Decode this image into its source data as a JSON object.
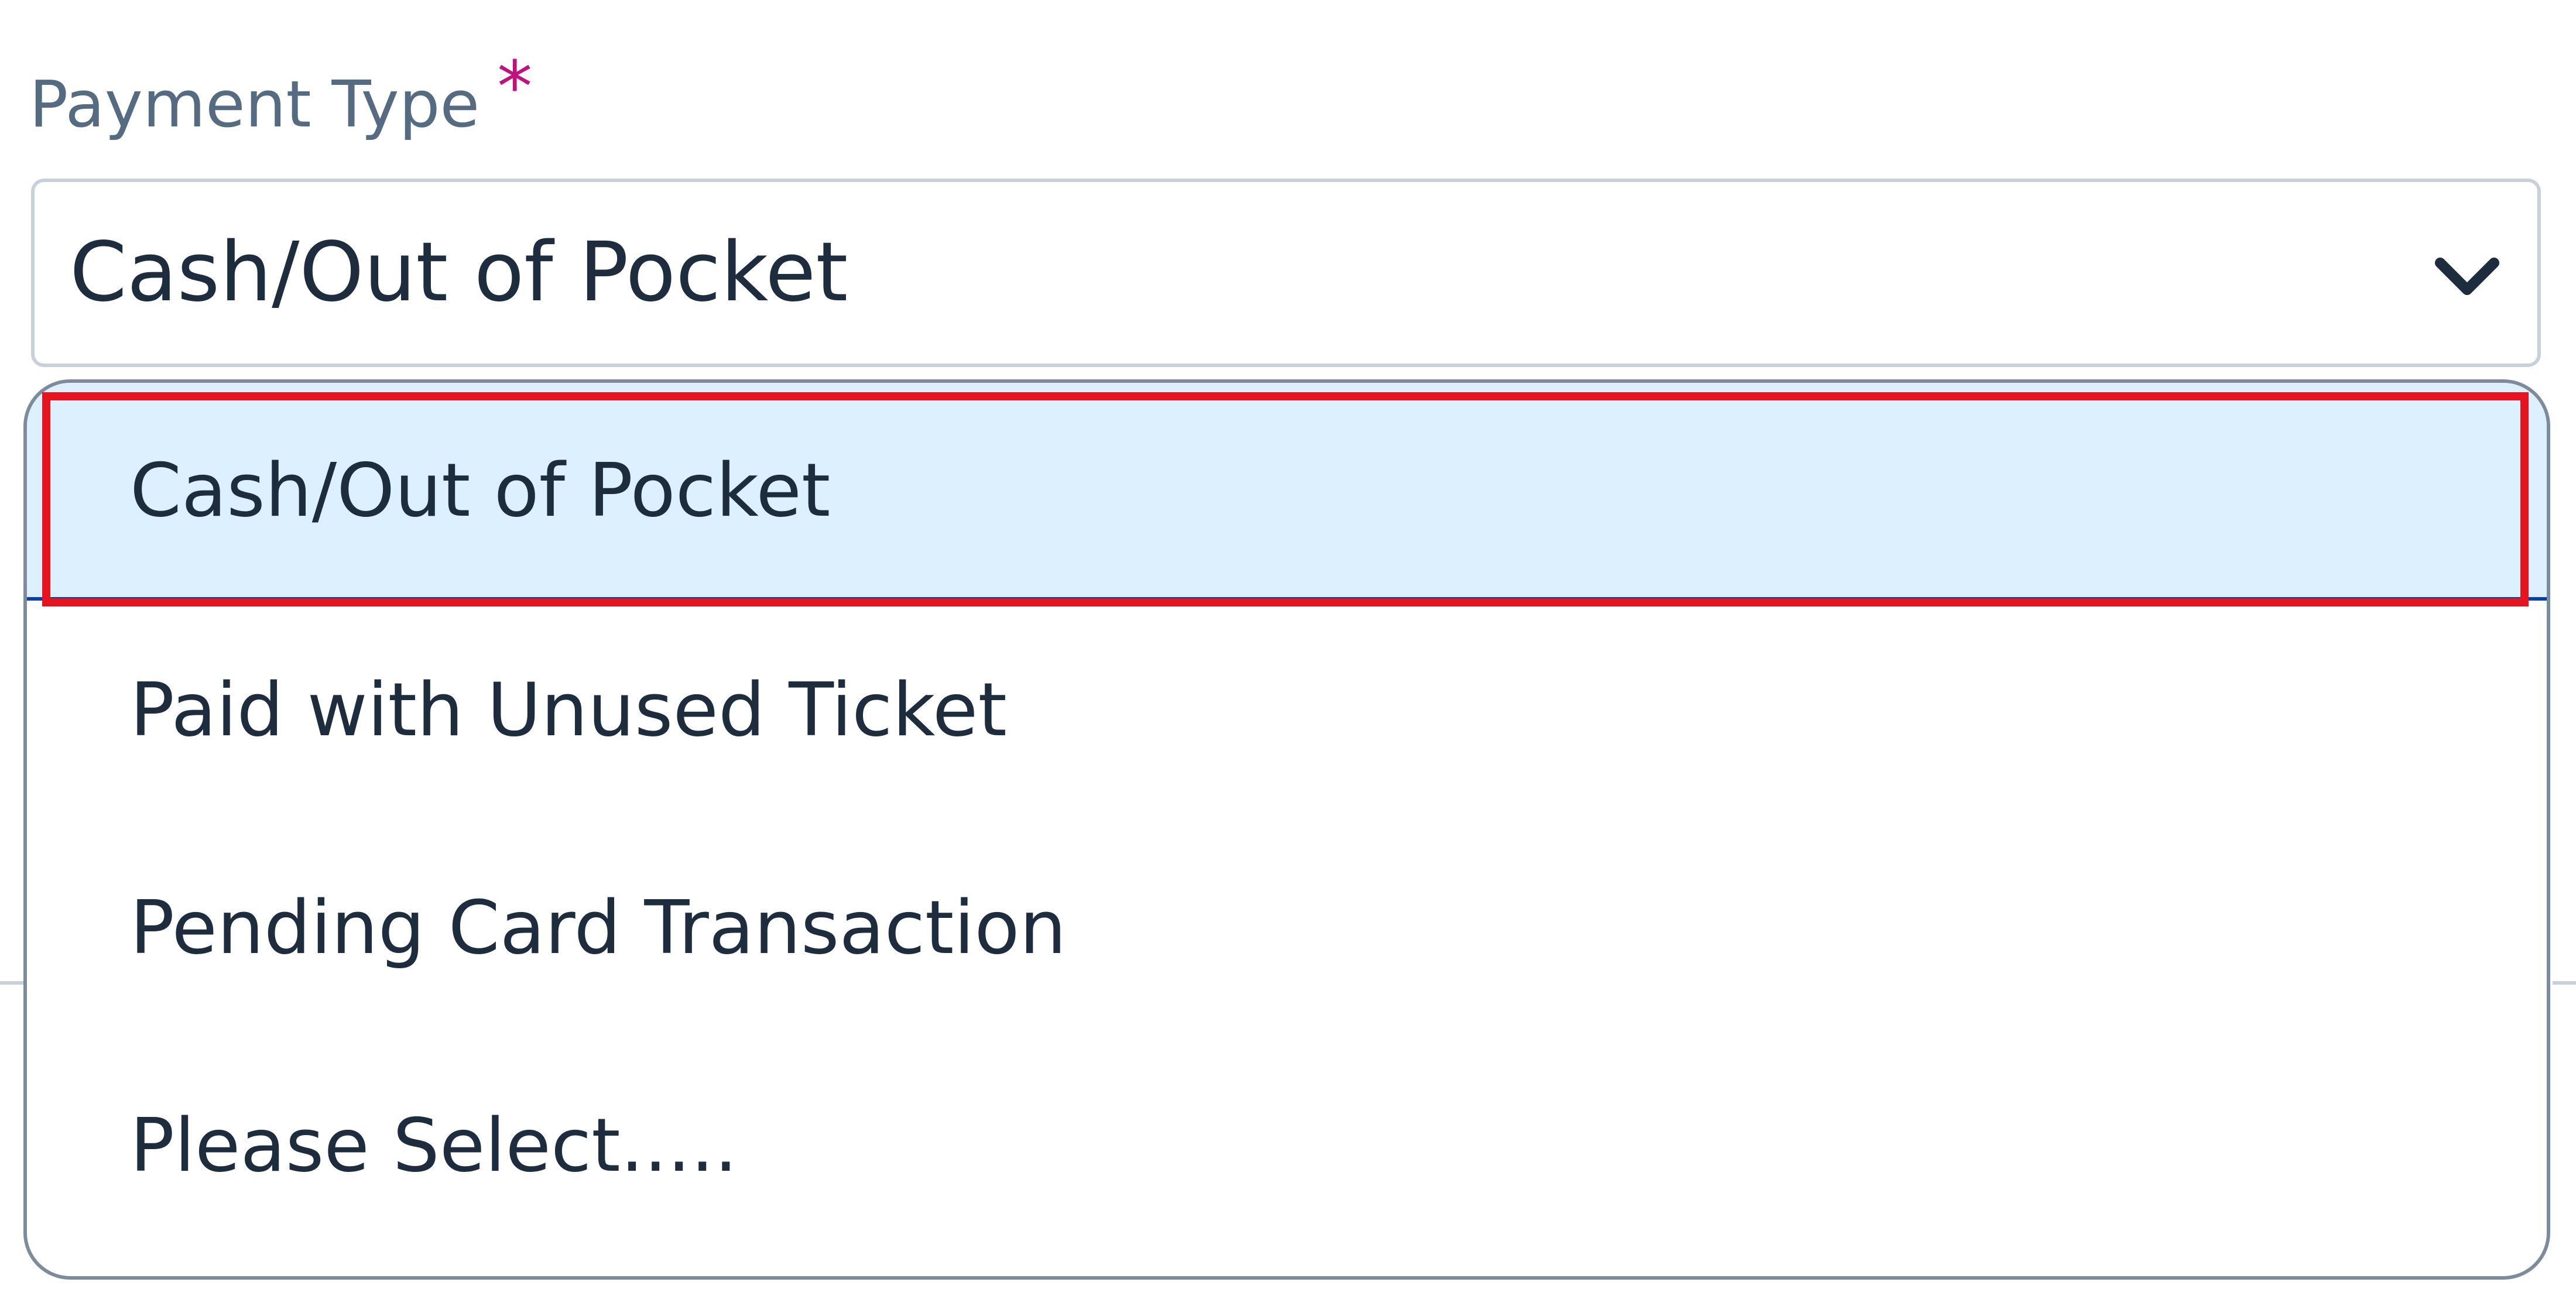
{
  "field": {
    "label": "Payment Type",
    "required_mark": "*",
    "selected_value": "Cash/Out of Pocket"
  },
  "dropdown": {
    "options": [
      {
        "label": "Cash/Out of Pocket",
        "selected": true
      },
      {
        "label": "Paid with Unused Ticket",
        "selected": false
      },
      {
        "label": "Pending Card Transaction",
        "selected": false
      },
      {
        "label": "Please Select.....",
        "selected": false
      }
    ]
  },
  "icons": {
    "arrow": "chevron-down-icon"
  },
  "colors": {
    "label_text": "#556b82",
    "required_mark": "#c0127a",
    "value_text": "#1d2d3e",
    "selected_option_bg": "#dcf0fd",
    "selected_option_underline": "#0a3ea8",
    "highlight_frame": "#e5141e",
    "field_border": "#c7d1dc",
    "popover_border": "#7d8c9c"
  }
}
